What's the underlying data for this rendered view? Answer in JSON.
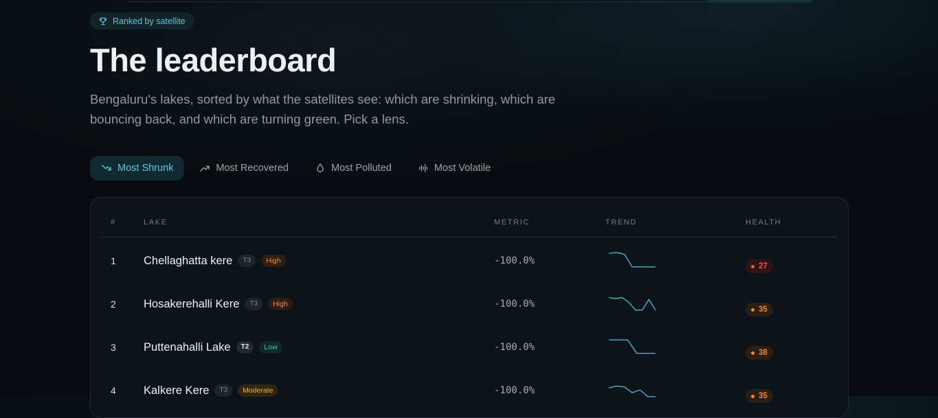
{
  "badge": {
    "label": "Ranked by satellite",
    "icon": "trophy-icon"
  },
  "page": {
    "title": "The leaderboard",
    "subtitle": "Bengaluru's lakes, sorted by what the satellites see: which are shrinking, which are bouncing back, and which are turning green. Pick a lens."
  },
  "tabs": [
    {
      "label": "Most Shrunk",
      "icon": "trend-down-icon",
      "active": true
    },
    {
      "label": "Most Recovered",
      "icon": "trend-up-icon",
      "active": false
    },
    {
      "label": "Most Polluted",
      "icon": "droplet-icon",
      "active": false
    },
    {
      "label": "Most Volatile",
      "icon": "waveform-icon",
      "active": false
    }
  ],
  "table": {
    "columns": [
      "#",
      "LAKE",
      "METRIC",
      "TREND",
      "HEALTH"
    ],
    "rows": [
      {
        "rank": "1",
        "name": "Chellaghatta kere",
        "tier": "T3",
        "risk": "High",
        "metric": "-100.0%",
        "health": "27",
        "health_color": "#f0553f",
        "trend": [
          0.85,
          0.9,
          0.8,
          0.15,
          0.15,
          0.15,
          0.15
        ]
      },
      {
        "rank": "2",
        "name": "Hosakerehalli Kere",
        "tier": "T3",
        "risk": "High",
        "metric": "-100.0%",
        "health": "35",
        "health_color": "#f0883a",
        "trend": [
          0.8,
          0.75,
          0.8,
          0.55,
          0.15,
          0.15,
          0.7,
          0.15
        ]
      },
      {
        "rank": "3",
        "name": "Puttenahalli Lake",
        "tier": "T2",
        "risk": "Low",
        "metric": "-100.0%",
        "health": "38",
        "health_color": "#f0883a",
        "trend": [
          0.85,
          0.85,
          0.85,
          0.15,
          0.15,
          0.15
        ]
      },
      {
        "rank": "4",
        "name": "Kalkere Kere",
        "tier": "T3",
        "risk": "Moderate",
        "metric": "-100.0%",
        "health": "35",
        "health_color": "#f0883a",
        "trend": [
          0.6,
          0.7,
          0.65,
          0.35,
          0.5,
          0.15,
          0.15
        ]
      }
    ]
  },
  "colors": {
    "accent": "#5ccbd9",
    "trend_line": "#3fb8cc"
  }
}
